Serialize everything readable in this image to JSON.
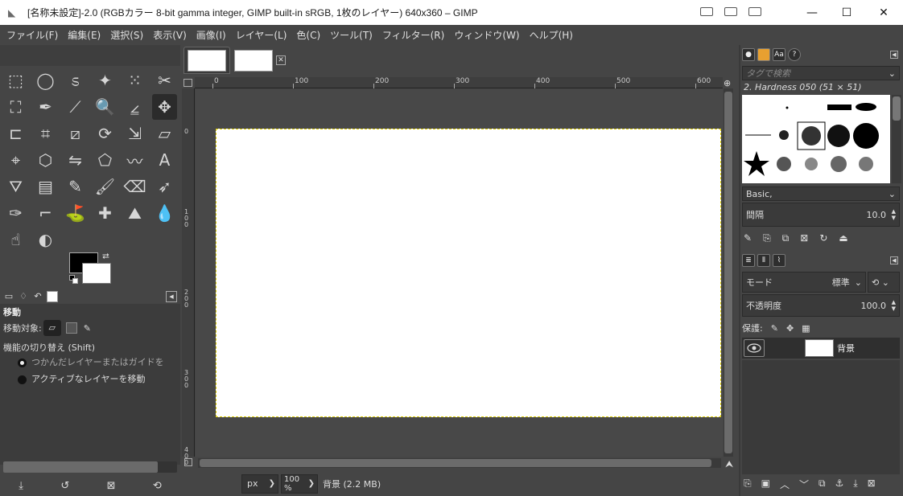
{
  "window": {
    "title": "[名称未設定]-2.0 (RGBカラー 8-bit gamma integer, GIMP built-in sRGB, 1枚のレイヤー) 640x360 – GIMP",
    "minimize": "—",
    "maximize": "☐",
    "close": "✕"
  },
  "menu": [
    "ファイル(F)",
    "編集(E)",
    "選択(S)",
    "表示(V)",
    "画像(I)",
    "レイヤー(L)",
    "色(C)",
    "ツール(T)",
    "フィルター(R)",
    "ウィンドウ(W)",
    "ヘルプ(H)"
  ],
  "toolbox": {
    "tools": [
      "rect-select",
      "ellipse-select",
      "free-select",
      "fuzzy-select",
      "select-by-color",
      "scissors",
      "foreground-select",
      "paths",
      "color-picker",
      "zoom",
      "measure",
      "move",
      "align",
      "crop",
      "unified-transform",
      "rotate",
      "scale",
      "shear",
      "handle-transform",
      "3d-transform",
      "flip",
      "cage",
      "warp",
      "text",
      "bucket-fill",
      "gradient",
      "pencil",
      "paintbrush",
      "eraser",
      "airbrush",
      "ink",
      "mypaint-brush",
      "clone",
      "heal",
      "perspective-clone",
      "blur",
      "smudge",
      "dodge-burn"
    ],
    "active_tool": "move",
    "fg_color": "#000000",
    "bg_color": "#ffffff"
  },
  "tool_options": {
    "title": "移動",
    "target_label": "移動対象:",
    "toggle_label": "機能の切り替え  (Shift)",
    "option1": "つかんだレイヤーまたはガイドを",
    "option2": "アクティブなレイヤーを移動"
  },
  "image": {
    "ruler_labels": [
      "0",
      "100",
      "200",
      "300",
      "400",
      "500",
      "600"
    ],
    "vruler_labels": [
      "0",
      "100",
      "200",
      "300",
      "400"
    ],
    "canvas_color": "#ffffff"
  },
  "status": {
    "unit": "px",
    "zoom": "100 %",
    "info": "背景 (2.2 MB)"
  },
  "brushes": {
    "tag_placeholder": "タグで検索",
    "brush_name": "2. Hardness 050 (51 × 51)",
    "preset": "Basic,",
    "spacing_label": "間隔",
    "spacing_value": "10.0"
  },
  "layers": {
    "mode_label": "モード",
    "mode_value": "標準",
    "opacity_label": "不透明度",
    "opacity_value": "100.0",
    "lock_label": "保護:",
    "layer_name": "背景"
  }
}
